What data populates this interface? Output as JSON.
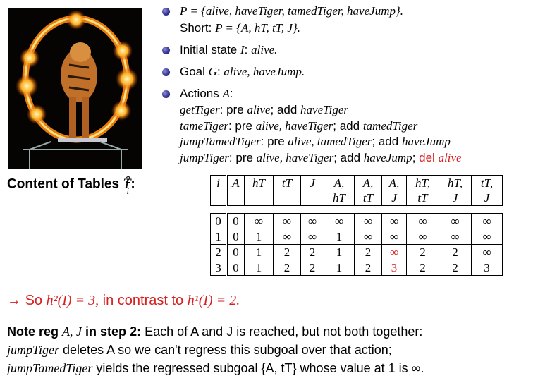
{
  "bullets": {
    "p_def": "P = {alive, haveTiger, tamedTiger, haveJump}.",
    "p_short_label": "Short:",
    "p_short": "P = {A, hT, tT, J}.",
    "initial_label": "Initial state",
    "initial_var": "I",
    "initial_value": "alive.",
    "goal_label": "Goal",
    "goal_var": "G",
    "goal_value": "alive, haveJump.",
    "actions_label": "Actions",
    "actions_var": "A",
    "actions": [
      {
        "name": "getTiger",
        "pre_kw": "pre",
        "pre": "alive",
        "add_kw": "add",
        "add": "haveTiger",
        "del_kw": "",
        "del": ""
      },
      {
        "name": "tameTiger",
        "pre_kw": "pre",
        "pre": "alive, haveTiger",
        "add_kw": "add",
        "add": "tamedTiger",
        "del_kw": "",
        "del": ""
      },
      {
        "name": "jumpTamedTiger",
        "pre_kw": "pre",
        "pre": "alive, tamedTiger",
        "add_kw": "add",
        "add": "haveJump",
        "del_kw": "",
        "del": ""
      },
      {
        "name": "jumpTiger",
        "pre_kw": "pre",
        "pre": "alive, haveTiger",
        "add_kw": "add",
        "add": "haveJump",
        "del_kw": "del",
        "del": "alive"
      }
    ]
  },
  "table_title": "Content of Tables",
  "table": {
    "headers": [
      [
        "i",
        ""
      ],
      [
        "A",
        ""
      ],
      [
        "hT",
        ""
      ],
      [
        "tT",
        ""
      ],
      [
        "J",
        ""
      ],
      [
        "A,",
        "hT"
      ],
      [
        "A,",
        "tT"
      ],
      [
        "A,",
        "J"
      ],
      [
        "hT,",
        "tT"
      ],
      [
        "hT,",
        "J"
      ],
      [
        "tT,",
        "J"
      ]
    ],
    "rows": [
      [
        "0",
        "0",
        "∞",
        "∞",
        "∞",
        "∞",
        "∞",
        "∞",
        "∞",
        "∞",
        "∞"
      ],
      [
        "1",
        "0",
        "1",
        "∞",
        "∞",
        "1",
        "∞",
        "∞",
        "∞",
        "∞",
        "∞"
      ],
      [
        "2",
        "0",
        "1",
        "2",
        "2",
        "1",
        "2",
        "∞",
        "2",
        "2",
        "∞"
      ],
      [
        "3",
        "0",
        "1",
        "2",
        "2",
        "1",
        "2",
        "3",
        "2",
        "2",
        "3"
      ]
    ],
    "highlighted_cells": [
      [
        2,
        7
      ],
      [
        3,
        7
      ]
    ],
    "highlight_color": "#d61f1f"
  },
  "conclusion": {
    "arrow": "→",
    "text1": "So",
    "h2": "h²(I) = 3,",
    "text2": "in contrast to",
    "h1": "h¹(I) = 2."
  },
  "note": {
    "lead_a": "Note reg",
    "lead_vars": "A, J",
    "lead_b": "in step",
    "lead_step": "2:",
    "line1_rest": "Each of A and J is reached, but not both together:",
    "line2_action": "jumpTiger",
    "line2_rest": "deletes A so we can't regress this subgoal over that action;",
    "line3_action": "jumpTamedTiger",
    "line3_rest": "yields the regressed subgoal {A, tT} whose value at 1 is ∞."
  },
  "colors": {
    "accent_red": "#d61f1f",
    "bullet": "#303090"
  }
}
